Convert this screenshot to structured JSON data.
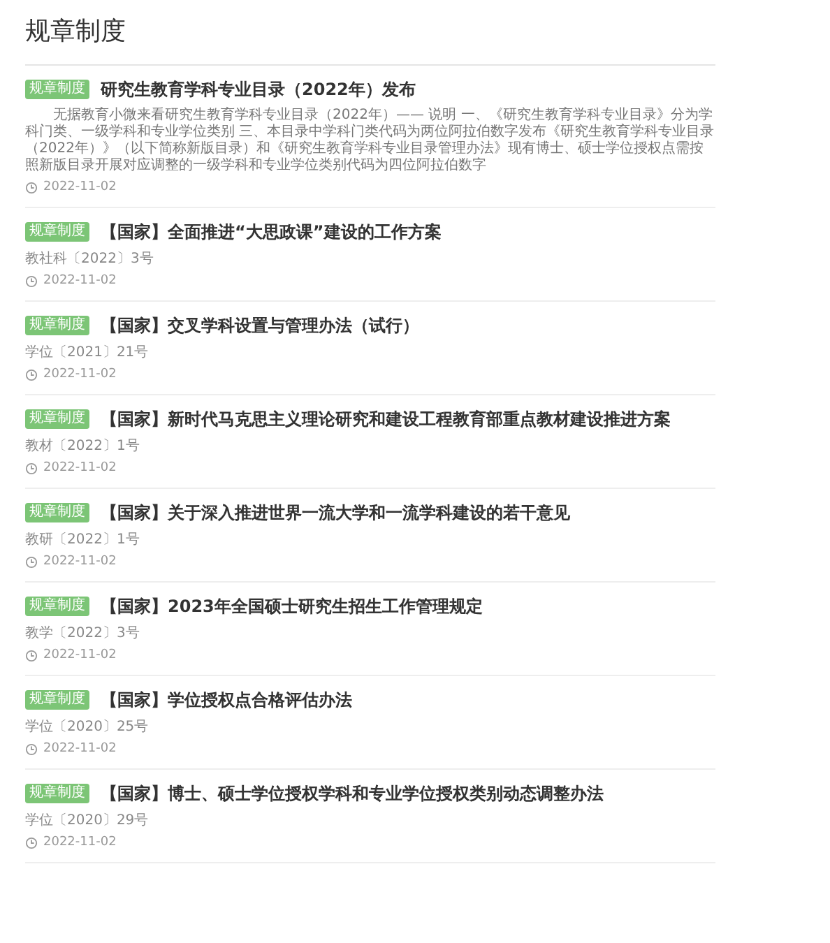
{
  "page_title": "规章制度",
  "articles": [
    {
      "badge": "规章制度",
      "title": "研究生教育学科专业目录（2022年）发布",
      "summary": "无据教育小微来看研究生教育学科专业目录（2022年）—— 说明 一、《研究生教育学科专业目录》分为学科门类、一级学科和专业学位类别 三、本目录中学科门类代码为两位阿拉伯数字发布《研究生教育学科专业目录（2022年）》（以下简称新版目录）和《研究生教育学科专业目录管理办法》现有博士、硕士学位授权点需按照新版目录开展对应调整的一级学科和专业学位类别代码为四位阿拉伯数字",
      "date": "2022-11-02"
    },
    {
      "badge": "规章制度",
      "title": "【国家】全面推进“大思政课”建设的工作方案",
      "doc_number": "教社科〔2022〕3号",
      "date": "2022-11-02"
    },
    {
      "badge": "规章制度",
      "title": "【国家】交叉学科设置与管理办法（试行）",
      "doc_number": "学位〔2021〕21号",
      "date": "2022-11-02"
    },
    {
      "badge": "规章制度",
      "title": "【国家】新时代马克思主义理论研究和建设工程教育部重点教材建设推进方案",
      "doc_number": "教材〔2022〕1号",
      "date": "2022-11-02"
    },
    {
      "badge": "规章制度",
      "title": "【国家】关于深入推进世界一流大学和一流学科建设的若干意见",
      "doc_number": "教研〔2022〕1号",
      "date": "2022-11-02"
    },
    {
      "badge": "规章制度",
      "title": "【国家】2023年全国硕士研究生招生工作管理规定",
      "doc_number": "教学〔2022〕3号",
      "date": "2022-11-02"
    },
    {
      "badge": "规章制度",
      "title": "【国家】学位授权点合格评估办法",
      "doc_number": "学位〔2020〕25号",
      "date": "2022-11-02"
    },
    {
      "badge": "规章制度",
      "title": "【国家】博士、硕士学位授权学科和专业学位授权类别动态调整办法",
      "doc_number": "学位〔2020〕29号",
      "date": "2022-11-02"
    }
  ]
}
